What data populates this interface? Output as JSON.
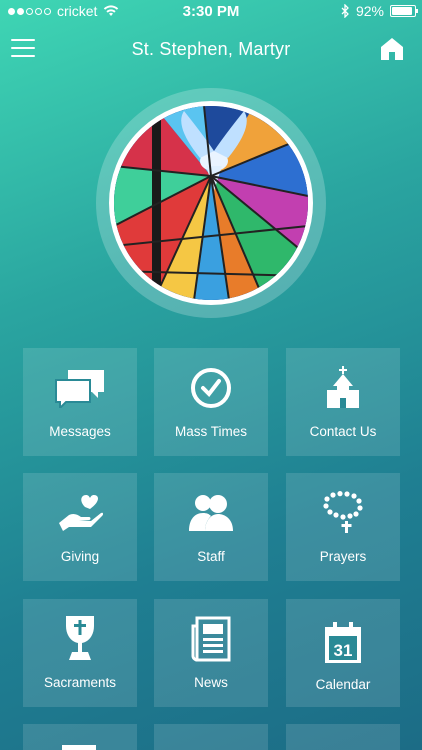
{
  "status_bar": {
    "carrier": "cricket",
    "time": "3:30 PM",
    "battery_percent": "92%",
    "battery_level": 0.92,
    "signal_bars_filled": 2,
    "signal_bars_total": 5
  },
  "nav": {
    "title": "St. Stephen, Martyr",
    "menu_icon": "hamburger-icon",
    "home_icon": "home-icon"
  },
  "hero": {
    "image": "stained-glass-dove"
  },
  "tiles": [
    {
      "label": "Messages",
      "icon": "chat-bubbles-icon"
    },
    {
      "label": "Mass Times",
      "icon": "clock-icon"
    },
    {
      "label": "Contact Us",
      "icon": "church-icon"
    },
    {
      "label": "Giving",
      "icon": "hand-heart-icon"
    },
    {
      "label": "Staff",
      "icon": "people-icon"
    },
    {
      "label": "Prayers",
      "icon": "rosary-icon"
    },
    {
      "label": "Sacraments",
      "icon": "chalice-icon"
    },
    {
      "label": "News",
      "icon": "newspaper-icon"
    },
    {
      "label": "Calendar",
      "icon": "calendar-icon",
      "day": "31"
    }
  ]
}
